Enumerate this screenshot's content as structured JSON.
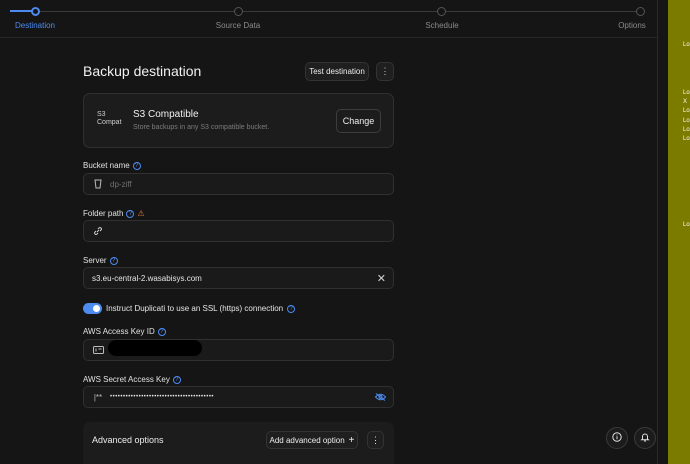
{
  "stepper": {
    "steps": [
      {
        "label": "Destination",
        "active": true
      },
      {
        "label": "Source Data",
        "active": false
      },
      {
        "label": "Schedule",
        "active": false
      },
      {
        "label": "Options",
        "active": false
      }
    ]
  },
  "header": {
    "title": "Backup destination",
    "test_button": "Test destination",
    "more_button": "⋮"
  },
  "destination_card": {
    "logo_alt": "S3 Compat",
    "title": "S3 Compatible",
    "description": "Store backups in any S3 compatible bucket.",
    "change_button": "Change"
  },
  "fields": {
    "bucket": {
      "label": "Bucket name",
      "placeholder": "dp-ziff",
      "value": ""
    },
    "folder": {
      "label": "Folder path",
      "value": ""
    },
    "server": {
      "label": "Server",
      "value": "s3.eu-central-2.wasabisys.com"
    },
    "ssl": {
      "label": "Instruct Duplicati to use an SSL (https) connection",
      "checked": true
    },
    "access_key": {
      "label": "AWS Access Key ID",
      "value": ""
    },
    "secret_key": {
      "label": "AWS Secret Access Key",
      "value": "••••••••••••••••••••••••••••••••••••••••"
    }
  },
  "advanced": {
    "title": "Advanced options",
    "add_button": "Add advanced option",
    "add_icon": "+",
    "more_button": "⋮"
  },
  "floating": {
    "info_icon": "info-icon",
    "bell_icon": "bell-icon"
  },
  "side_panel": {
    "lines": [
      "Lo",
      "Lo",
      "X",
      "Lo",
      "Lo",
      "Lo",
      "Lo",
      "Lo"
    ]
  },
  "colors": {
    "accent": "#4d8bf0",
    "warning": "#e07a3b",
    "side_panel": "#7b7b00"
  }
}
